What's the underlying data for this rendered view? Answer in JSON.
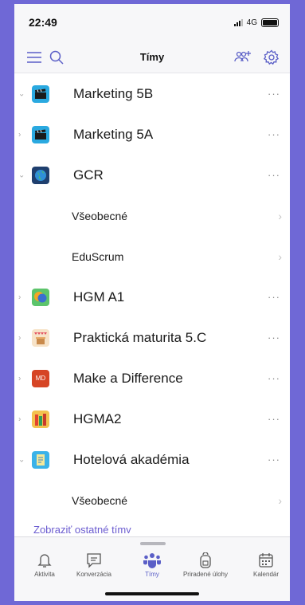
{
  "status_bar": {
    "time": "22:49",
    "network": "4G"
  },
  "header": {
    "title": "Tímy"
  },
  "rows": [
    {
      "type": "team",
      "name": "Marketing 5B",
      "expanded": true,
      "avatar_color": "#2aa9e0",
      "avatar_icon": "clapperboard-icon"
    },
    {
      "type": "team",
      "name": "Marketing 5A",
      "expanded": false,
      "avatar_color": "#2aa9e0",
      "avatar_icon": "clapperboard-icon"
    },
    {
      "type": "team",
      "name": "GCR",
      "expanded": true,
      "avatar_color": "#1f3f6e",
      "avatar_icon": "globe-icon"
    },
    {
      "type": "channel",
      "name": "Všeobecné"
    },
    {
      "type": "channel",
      "name": "EduScrum"
    },
    {
      "type": "team",
      "name": "HGM A1",
      "expanded": false,
      "avatar_color": "#5cc46b",
      "avatar_icon": "chat-bubbles-icon"
    },
    {
      "type": "team",
      "name": "Praktická maturita 5.C",
      "expanded": false,
      "avatar_color": "#f7e3c8",
      "avatar_icon": "party-icon"
    },
    {
      "type": "team",
      "name": "Make a Difference",
      "expanded": false,
      "avatar_color": "#d64525",
      "avatar_text": "MD"
    },
    {
      "type": "team",
      "name": "HGMA2",
      "expanded": false,
      "avatar_color": "#f3c24e",
      "avatar_icon": "books-icon"
    },
    {
      "type": "team",
      "name": "Hotelová akadémia",
      "expanded": true,
      "avatar_color": "#3bb2e8",
      "avatar_icon": "document-icon"
    },
    {
      "type": "channel",
      "name": "Všeobecné"
    }
  ],
  "partial_link": "Zobraziť ostatné tímy",
  "tabs": [
    {
      "label": "Aktivita",
      "icon": "bell-icon",
      "active": false
    },
    {
      "label": "Konverzácia",
      "icon": "chat-icon",
      "active": false
    },
    {
      "label": "Tímy",
      "icon": "teams-icon",
      "active": true
    },
    {
      "label": "Priradené úlohy",
      "icon": "backpack-icon",
      "active": false
    },
    {
      "label": "Kalendár",
      "icon": "calendar-icon",
      "active": false
    }
  ],
  "colors": {
    "accent": "#5b5fc7",
    "background": "#6f68d6"
  }
}
